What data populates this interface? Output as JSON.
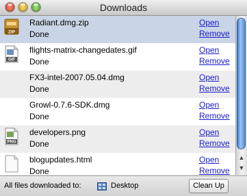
{
  "window": {
    "title": "Downloads"
  },
  "downloads": [
    {
      "name": "Radiant.dmg.zip",
      "status": "Done",
      "open": "Open",
      "remove": "Remove",
      "icon": "zip-icon",
      "icon_label": "ZIP"
    },
    {
      "name": "flights-matrix-changedates.gif",
      "status": "Done",
      "open": "Open",
      "remove": "Remove",
      "icon": "gif-file-icon",
      "icon_label": "GIF"
    },
    {
      "name": "FX3-intel-2007.05.04.dmg",
      "status": "Done",
      "open": "Open",
      "remove": "Remove",
      "icon": "",
      "icon_label": ""
    },
    {
      "name": "Growl-0.7.6-SDK.dmg",
      "status": "Done",
      "open": "Open",
      "remove": "Remove",
      "icon": "",
      "icon_label": ""
    },
    {
      "name": "developers.png",
      "status": "Done",
      "open": "Open",
      "remove": "Remove",
      "icon": "png-file-icon",
      "icon_label": "PNG"
    },
    {
      "name": "blogupdates.html",
      "status": "Done",
      "open": "Open",
      "remove": "Remove",
      "icon": "document-icon",
      "icon_label": ""
    }
  ],
  "footer": {
    "label": "All files downloaded to:",
    "folder": "Desktop",
    "cleanup": "Clean Up"
  },
  "colors": {
    "link": "#1a1acc",
    "selected_row": "#c9d5e6"
  }
}
